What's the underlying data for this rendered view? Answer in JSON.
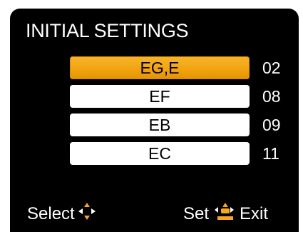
{
  "title": "INITIAL SETTINGS",
  "rows": [
    {
      "label": "EG,E",
      "value": "02",
      "selected": true
    },
    {
      "label": "EF",
      "value": "08",
      "selected": false
    },
    {
      "label": "EB",
      "value": "09",
      "selected": false
    },
    {
      "label": "EC",
      "value": "11",
      "selected": false
    }
  ],
  "footer": {
    "select_label": "Select",
    "select_icon": "four-way-arrows-icon",
    "set_label": "Set",
    "set_exit_icon": "set-exit-dpad-icon",
    "exit_label": "Exit"
  },
  "colors": {
    "screen_bg": "#000000",
    "row_bg": "#ffffff",
    "selected_bg": "#f2a20f",
    "icon_accent": "#f5a623"
  }
}
